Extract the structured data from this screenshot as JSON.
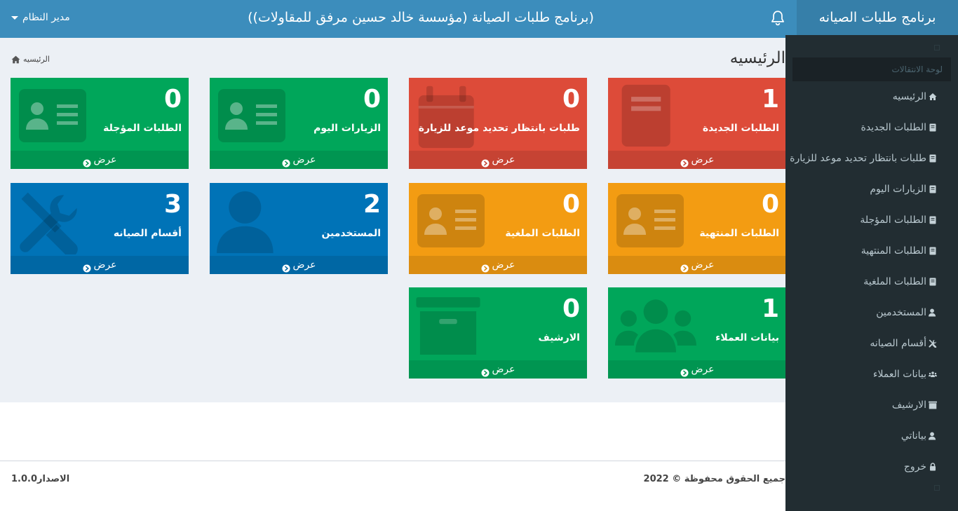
{
  "header": {
    "brand": "برنامج طلبات الصيانه",
    "title": "(برنامج طلبات الصيانة (مؤسسة خالد حسين مرفق للمقاولات))",
    "user": "مدير النظام"
  },
  "content": {
    "page_title": "الرئيسيه",
    "breadcrumb": "الرئيسيه"
  },
  "boxes": [
    {
      "count": "1",
      "label": "الطلبات الجديدة",
      "link": "عرض",
      "color": "#dd4b39",
      "foot_color": "#c64333",
      "icon": "book-icon"
    },
    {
      "count": "0",
      "label": "طلبات بانتظار تحديد موعد للزيارة",
      "link": "عرض",
      "color": "#dd4b39",
      "foot_color": "#c64333",
      "icon": "calendar-icon"
    },
    {
      "count": "0",
      "label": "الزيارات اليوم",
      "link": "عرض",
      "color": "#00a65a",
      "foot_color": "#009551",
      "icon": "id-card-icon"
    },
    {
      "count": "0",
      "label": "الطلبات المؤجلة",
      "link": "عرض",
      "color": "#00a65a",
      "foot_color": "#009551",
      "icon": "id-card-icon"
    },
    {
      "count": "0",
      "label": "الطلبات المنتهية",
      "link": "عرض",
      "color": "#f39c12",
      "foot_color": "#da8c10",
      "icon": "id-card-icon"
    },
    {
      "count": "0",
      "label": "الطلبات الملغية",
      "link": "عرض",
      "color": "#f39c12",
      "foot_color": "#da8c10",
      "icon": "id-card-icon"
    },
    {
      "count": "2",
      "label": "المستخدمين",
      "link": "عرض",
      "color": "#0073b7",
      "foot_color": "#0067a4",
      "icon": "user-icon"
    },
    {
      "count": "3",
      "label": "أقسام الصيانه",
      "link": "عرض",
      "color": "#0073b7",
      "foot_color": "#0067a4",
      "icon": "tools-icon"
    },
    {
      "count": "1",
      "label": "بيانات العملاء",
      "link": "عرض",
      "color": "#00a65a",
      "foot_color": "#009551",
      "icon": "users-icon"
    },
    {
      "count": "0",
      "label": "الارشيف",
      "link": "عرض",
      "color": "#00a65a",
      "foot_color": "#009551",
      "icon": "archive-icon"
    }
  ],
  "sidebar": {
    "header": "لوحة الانتقالات",
    "items": [
      {
        "label": "الرئيسيه",
        "icon": "home-icon"
      },
      {
        "label": "الطلبات الجديدة",
        "icon": "book-icon"
      },
      {
        "label": "طلبات بانتظار تحديد موعد للزيارة",
        "icon": "book-icon"
      },
      {
        "label": "الزيارات اليوم",
        "icon": "book-icon"
      },
      {
        "label": "الطلبات المؤجلة",
        "icon": "book-icon"
      },
      {
        "label": "الطلبات المنتهية",
        "icon": "book-icon"
      },
      {
        "label": "الطلبات الملغية",
        "icon": "book-icon"
      },
      {
        "label": "المستخدمين",
        "icon": "user-icon"
      },
      {
        "label": "أقسام الصيانه",
        "icon": "tools-icon"
      },
      {
        "label": "بيانات العملاء",
        "icon": "users-icon"
      },
      {
        "label": "الارشيف",
        "icon": "archive-icon"
      },
      {
        "label": "بياناتي",
        "icon": "user-icon"
      },
      {
        "label": "خروج",
        "icon": "lock-icon"
      }
    ]
  },
  "footer": {
    "copyright": "جميع الحقوق محفوظة © 2022",
    "version": "الاصدار1.0.0"
  }
}
